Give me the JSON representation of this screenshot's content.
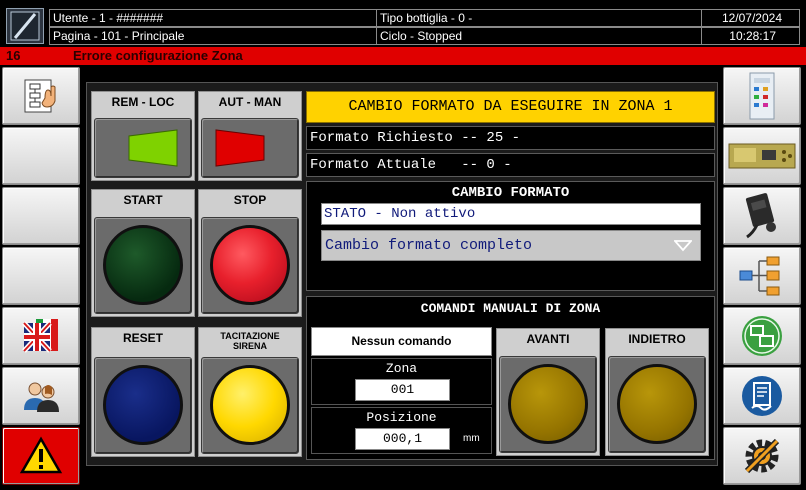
{
  "header": {
    "user": "Utente - 1 - #######",
    "bottle_type": "Tipo bottiglia - 0 -",
    "date": "12/07/2024",
    "page": "Pagina - 101 - Principale",
    "cycle": "Ciclo - Stopped",
    "time": "10:28:17"
  },
  "alarm": {
    "code": "16",
    "message": "Errore configurazione Zona"
  },
  "controls": {
    "rem_loc": "REM - LOC",
    "aut_man": "AUT - MAN",
    "start": "START",
    "stop": "STOP",
    "reset": "RESET",
    "siren": "TACITAZIONE SIRENA"
  },
  "format": {
    "banner": "CAMBIO FORMATO DA ESEGUIRE IN ZONA 1",
    "requested": "Formato Richiesto -- 25 -",
    "current": "Formato Attuale   -- 0 -"
  },
  "format_change": {
    "title": "CAMBIO FORMATO",
    "state": "STATO - Non attivo",
    "selected": "Cambio formato completo"
  },
  "manual": {
    "title": "COMANDI MANUALI DI ZONA",
    "command": "Nessun comando",
    "zone_label": "Zona",
    "zone_value": "001",
    "position_label": "Posizione",
    "position_value": "000,1",
    "unit": "mm",
    "forward": "AVANTI",
    "back": "INDIETRO"
  },
  "icons": {
    "left": [
      "flowchart-hand-icon",
      "empty",
      "empty",
      "empty",
      "uk-italy-flag-icon",
      "users-icon",
      "warning-icon"
    ],
    "right": [
      "control-panel-icon",
      "circuit-board-icon",
      "sensor-device-icon",
      "network-tree-icon",
      "screens-icon",
      "document-icon",
      "settings-tools-icon"
    ]
  },
  "colors": {
    "alarm": "#e00000",
    "banner": "#ffd200",
    "start": "#0a3a14",
    "stop": "#e8202c",
    "reset": "#0a1a6e",
    "siren": "#ffd800",
    "manual": "#9a7a00",
    "rem_arrow": "#7fd200",
    "aut_arrow": "#e00000"
  }
}
